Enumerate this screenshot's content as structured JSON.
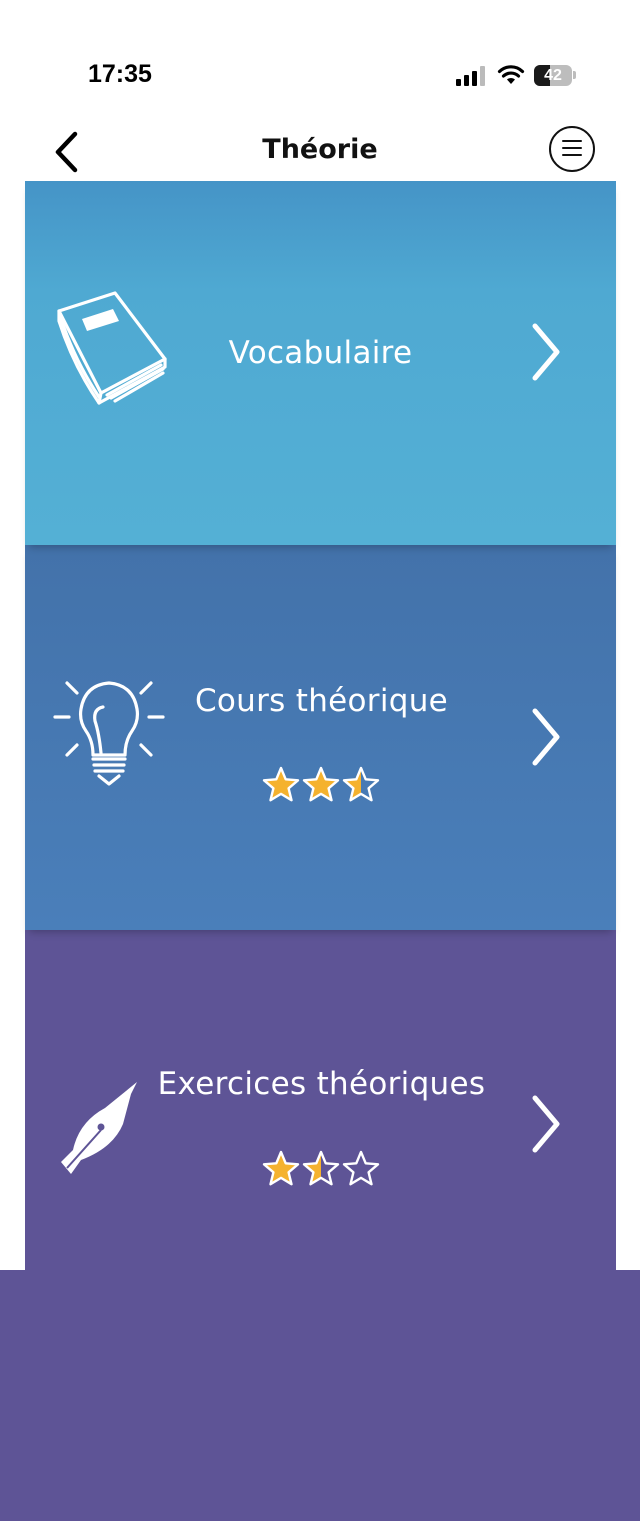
{
  "status_bar": {
    "time": "17:35",
    "battery_level": "42",
    "battery_fraction": 0.42
  },
  "nav": {
    "title": "Théorie",
    "back_icon": "chevron-left-icon",
    "menu_icon": "hamburger-circle-icon"
  },
  "cards": [
    {
      "label": "Vocabulaire",
      "icon": "book-icon",
      "rating": null,
      "color": "#54b0d5"
    },
    {
      "label": "Cours théorique",
      "icon": "lightbulb-icon",
      "rating": 2.5,
      "rating_max": 3,
      "color": "#4a7fba"
    },
    {
      "label": "Exercices théoriques",
      "icon": "fountain-pen-icon",
      "rating": 1.5,
      "rating_max": 3,
      "color": "#5e5496"
    }
  ],
  "colors": {
    "star_fill": "#f5b22e",
    "star_outline": "#ffffff"
  }
}
